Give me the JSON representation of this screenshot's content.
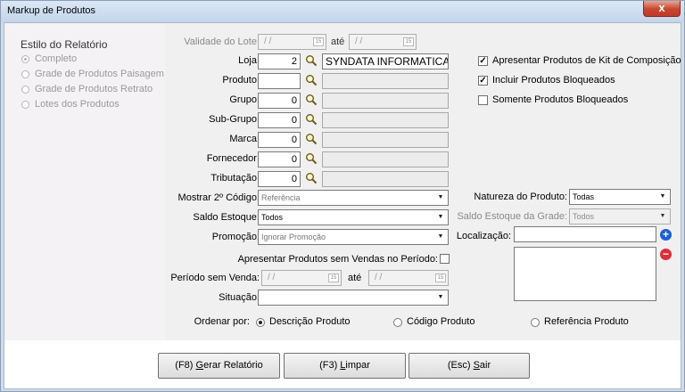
{
  "window": {
    "title": "Markup de Produtos",
    "close_glyph": "x"
  },
  "left_panel": {
    "heading": "Estilo do Relatório",
    "options": [
      {
        "label": "Completo",
        "selected": true
      },
      {
        "label": "Grade de Produtos Paisagem",
        "selected": false
      },
      {
        "label": "Grade de Produtos Retrato",
        "selected": false
      },
      {
        "label": "Lotes dos Produtos",
        "selected": false
      }
    ]
  },
  "form": {
    "validade_label": "Validade do Lote:",
    "validade_start": "/ /",
    "validade_sep": "até",
    "validade_end": "/ /",
    "calendar_glyph": "15",
    "loja_label": "Loja:",
    "loja_code": "2",
    "loja_name": "SYNDATA INFORMATICA E AU",
    "produto_label": "Produto:",
    "produto_code": "",
    "produto_name": "",
    "grupo_label": "Grupo:",
    "grupo_code": "0",
    "subgrupo_label": "Sub-Grupo:",
    "subgrupo_code": "0",
    "marca_label": "Marca:",
    "marca_code": "0",
    "fornecedor_label": "Fornecedor:",
    "fornecedor_code": "0",
    "tributacao_label": "Tributação:",
    "tributacao_code": "0",
    "mostrar_label": "Mostrar 2º Código:",
    "mostrar_value": "Referência",
    "saldo_label": "Saldo Estoque:",
    "saldo_value": "Todos",
    "promocao_label": "Promoção:",
    "promocao_value": "Ignorar Promoção",
    "sem_vendas_label": "Apresentar Produtos sem Vendas no Período:",
    "periodo_label": "Período sem Venda:",
    "periodo_start": "/ /",
    "periodo_sep": "até",
    "periodo_end": "/ /",
    "situacao_label": "Situação:",
    "situacao_value": ""
  },
  "right": {
    "checkboxes": [
      {
        "label": "Apresentar Produtos de Kit de Composição",
        "checked": true
      },
      {
        "label": "Incluir Produtos Bloqueados",
        "checked": true
      },
      {
        "label": "Somente Produtos Bloqueados",
        "checked": false
      }
    ],
    "natureza_label": "Natureza do Produto:",
    "natureza_value": "Todas",
    "saldo_grade_label": "Saldo Estoque da Grade:",
    "saldo_grade_value": "Todos",
    "localizacao_label": "Localização:",
    "localizacao_value": "",
    "add_glyph": "+",
    "remove_glyph": "−"
  },
  "ordenar": {
    "label": "Ordenar por:",
    "options": [
      {
        "label": "Descrição Produto",
        "selected": true
      },
      {
        "label": "Código Produto",
        "selected": false
      },
      {
        "label": "Referência Produto",
        "selected": false
      }
    ]
  },
  "buttons": {
    "gerar": {
      "prefix": "(F8) ",
      "underlined": "G",
      "rest": "erar Relatório"
    },
    "limpar": {
      "prefix": "(F3) ",
      "underlined": "L",
      "rest": "impar"
    },
    "sair": {
      "prefix": "(Esc) ",
      "underlined": "S",
      "rest": "air"
    }
  },
  "colors": {
    "add": "#1c5fd6",
    "remove": "#d9303b",
    "accent": "#cfdcec"
  }
}
